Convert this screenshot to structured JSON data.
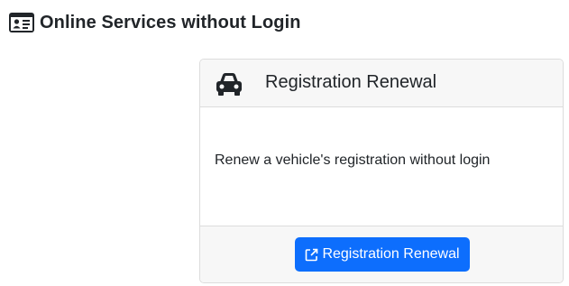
{
  "header": {
    "title": "Online Services without Login",
    "icon": "id-card-icon"
  },
  "card": {
    "icon": "car-icon",
    "title": "Registration Renewal",
    "description": "Renew a vehicle's registration without login",
    "button": {
      "label": "Registration Renewal",
      "icon": "external-link-icon",
      "color": "#0d6efd"
    }
  }
}
